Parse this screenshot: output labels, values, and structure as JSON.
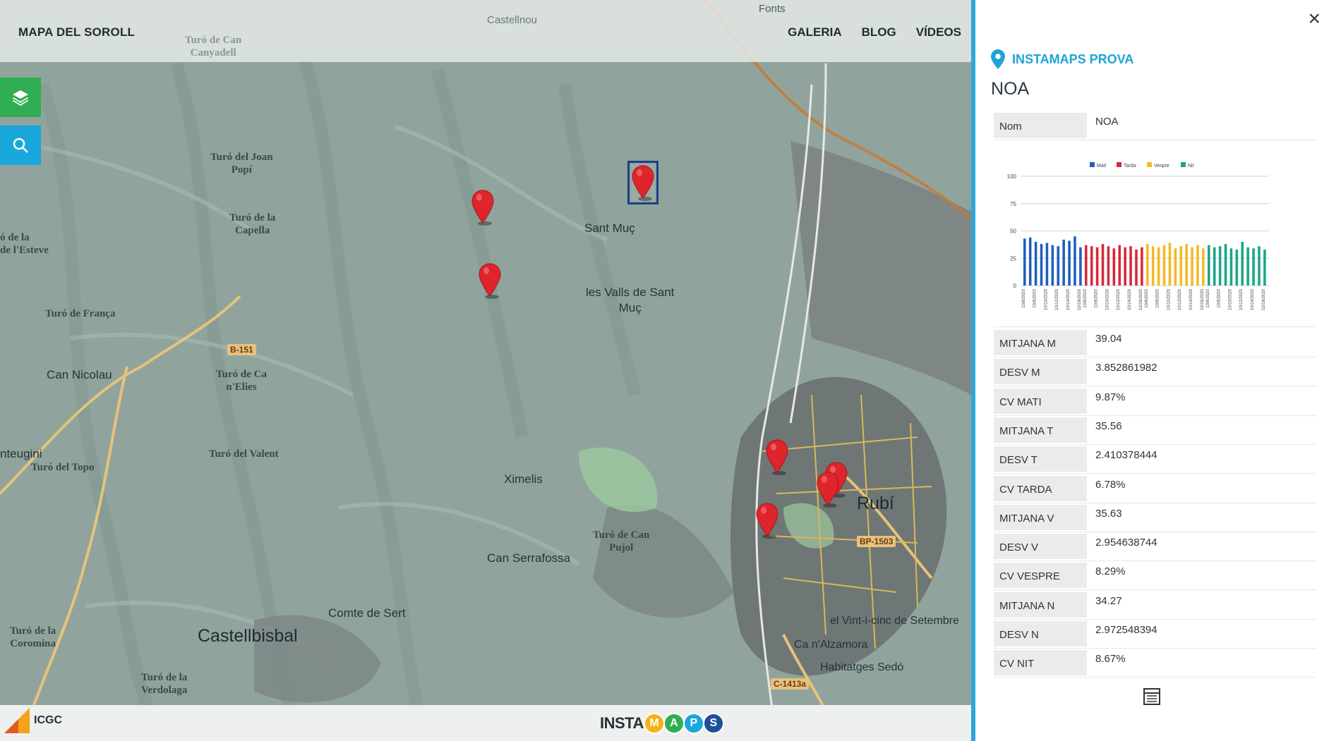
{
  "header": {
    "brand": "MAPA DEL SOROLL",
    "nav": [
      "GALERIA",
      "BLOG",
      "VÍDEOS"
    ]
  },
  "map": {
    "labels": {
      "fonts": "Fonts",
      "castellnou": "Castellnou",
      "turo_can_canyadell": "Turó de Can\nCanyadell",
      "turo_joan_popi": "Turó del Joan\nPopí",
      "turo_capella": "Turó de la\nCapella",
      "turo_esteve": "ó de la\nde l'Esteve",
      "turo_franca": "Turó de França",
      "can_nicolau": "Can Nicolau",
      "turo_can_elies": "Turó de Ca\nn'Elies",
      "turo_valent": "Turó del Valent",
      "ntaugini": "nteugini",
      "turo_topo": "Turó del Topo",
      "sant_muc": "Sant Muç",
      "valls_sant_muc": "les Valls de Sant\nMuç",
      "ximelis": "Ximelis",
      "can_serrafossa": "Can Serrafossa",
      "turo_can_pujol": "Turó de Can\nPujol",
      "rubi": "Rubí",
      "comte_sert": "Comte de Sert",
      "castellbisbal": "Castellbisbal",
      "turo_coromina": "Turó de la\nCoromina",
      "turo_verdolaga": "Turó de la\nVerdolaga",
      "vint_i_cinc": "el Vint-i-cinc de Setembre",
      "can_alzamora": "Ca n'Alzamora",
      "habitatges_sedo": "Habitatges Sedó"
    },
    "roads": {
      "b151": "B-151",
      "bp1503": "BP-1503",
      "c1413a": "C-1413a"
    },
    "marker_color": "#e0242b",
    "selected_marker_border": "#1f3e86"
  },
  "footer": {
    "icgc_label": "ICGC",
    "instamaps_prefix": "INSTA",
    "instamaps_letters": [
      {
        "letter": "M",
        "color": "#f6b21a"
      },
      {
        "letter": "A",
        "color": "#2fae54"
      },
      {
        "letter": "P",
        "color": "#1aa7dc"
      },
      {
        "letter": "S",
        "color": "#1f4f9a"
      }
    ]
  },
  "panel": {
    "close": "×",
    "source": "INSTAMAPS PROVA",
    "name": "NOA",
    "nom_key": "Nom",
    "nom_value": "NOA",
    "stats": [
      {
        "key": "MITJANA M",
        "value": "39.04"
      },
      {
        "key": "DESV M",
        "value": "3.852861982"
      },
      {
        "key": "CV MATI",
        "value": "9.87%"
      },
      {
        "key": "MITJANA T",
        "value": "35.56"
      },
      {
        "key": "DESV T",
        "value": "2.410378444"
      },
      {
        "key": "CV TARDA",
        "value": "6.78%"
      },
      {
        "key": "MITJANA V",
        "value": "35.63"
      },
      {
        "key": "DESV V",
        "value": "2.954638744"
      },
      {
        "key": "CV VESPRE",
        "value": "8.29%"
      },
      {
        "key": "MITJANA N",
        "value": "34.27"
      },
      {
        "key": "DESV N",
        "value": "2.972548394"
      },
      {
        "key": "CV NIT",
        "value": "8.67%"
      }
    ]
  },
  "chart_data": {
    "type": "bar",
    "title": "",
    "xlabel": "",
    "ylabel": "",
    "ylim": [
      0,
      100
    ],
    "yticks": [
      0,
      25,
      50,
      75,
      100
    ],
    "grid": true,
    "legend": "top",
    "categories": [
      "10/6/2020",
      "10/7/2020",
      "10/8/2020",
      "10/9/2020",
      "10/10/2020",
      "10/11/2020",
      "10/12/2020",
      "10/13/2020",
      "10/14/2020",
      "10/15/2020",
      "10/16/2020"
    ],
    "series": [
      {
        "name": "Matí",
        "color": "#1f5fbf",
        "values": [
          43,
          44,
          40,
          38,
          39,
          37,
          36,
          42,
          41,
          45,
          35
        ]
      },
      {
        "name": "Tarda",
        "color": "#d8283a",
        "values": [
          37,
          36,
          35,
          38,
          36,
          34,
          37,
          35,
          36,
          33,
          35
        ]
      },
      {
        "name": "Vespre",
        "color": "#f3b928",
        "values": [
          38,
          36,
          35,
          37,
          39,
          34,
          36,
          38,
          35,
          37,
          34
        ]
      },
      {
        "name": "Nit",
        "color": "#1aa687",
        "values": [
          37,
          35,
          36,
          38,
          34,
          33,
          40,
          35,
          34,
          36,
          33
        ]
      }
    ]
  }
}
